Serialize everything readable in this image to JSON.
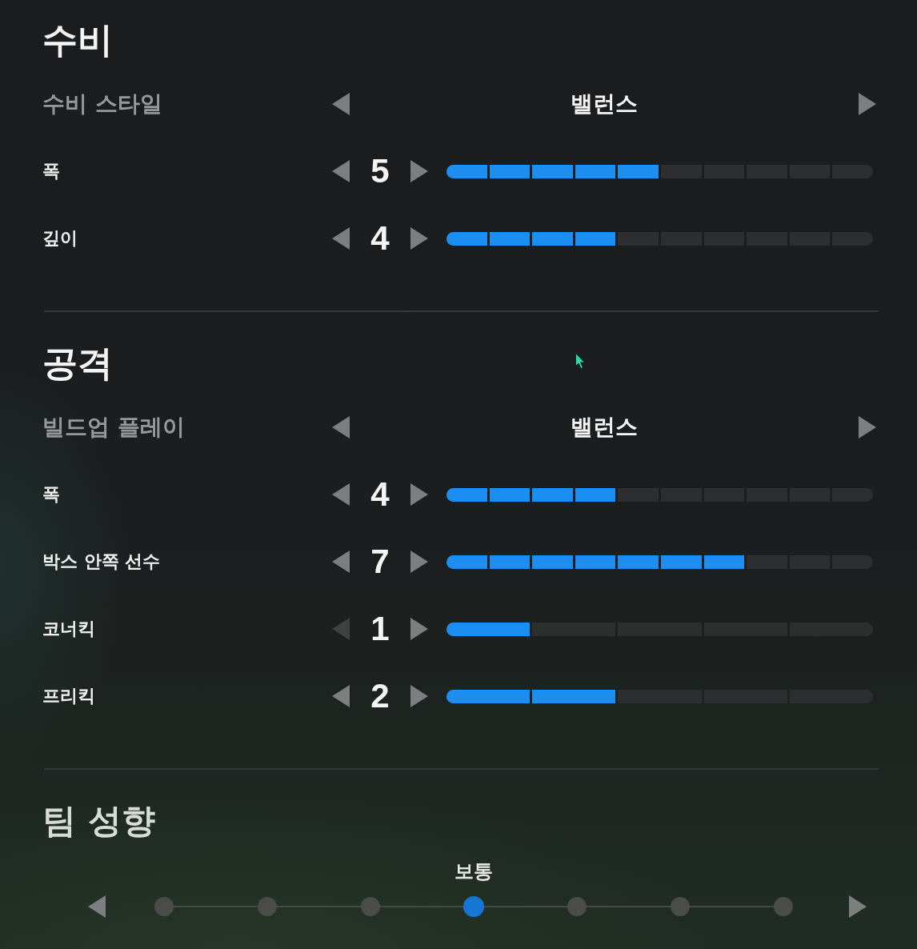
{
  "sections": [
    {
      "title": "수비",
      "rows": [
        {
          "kind": "selector",
          "label": "수비 스타일",
          "value": "밸런스",
          "decrease_disabled": false
        },
        {
          "kind": "steps10",
          "label": "폭",
          "value": "5",
          "level": 0.5,
          "decrease_disabled": false
        },
        {
          "kind": "steps10",
          "label": "깊이",
          "value": "4",
          "level": 0.4,
          "decrease_disabled": false
        }
      ]
    },
    {
      "title": "공격",
      "rows": [
        {
          "kind": "selector",
          "label": "빌드업 플레이",
          "value": "밸런스",
          "decrease_disabled": false
        },
        {
          "kind": "steps10",
          "label": "폭",
          "value": "4",
          "level": 0.4,
          "decrease_disabled": false
        },
        {
          "kind": "steps10",
          "label": "박스 안쪽 선수",
          "value": "7",
          "level": 0.7,
          "decrease_disabled": false
        },
        {
          "kind": "steps5",
          "label": "코너킥",
          "value": "1",
          "level": 0.2,
          "decrease_disabled": true
        },
        {
          "kind": "steps5",
          "label": "프리킥",
          "value": "2",
          "level": 0.4,
          "decrease_disabled": false
        }
      ]
    }
  ],
  "team_tendency": {
    "title": "팀 성향",
    "value": "보통",
    "steps": [
      {
        "selected": false
      },
      {
        "selected": false
      },
      {
        "selected": false
      },
      {
        "selected": true
      },
      {
        "selected": false
      },
      {
        "selected": false
      },
      {
        "selected": false
      }
    ]
  }
}
